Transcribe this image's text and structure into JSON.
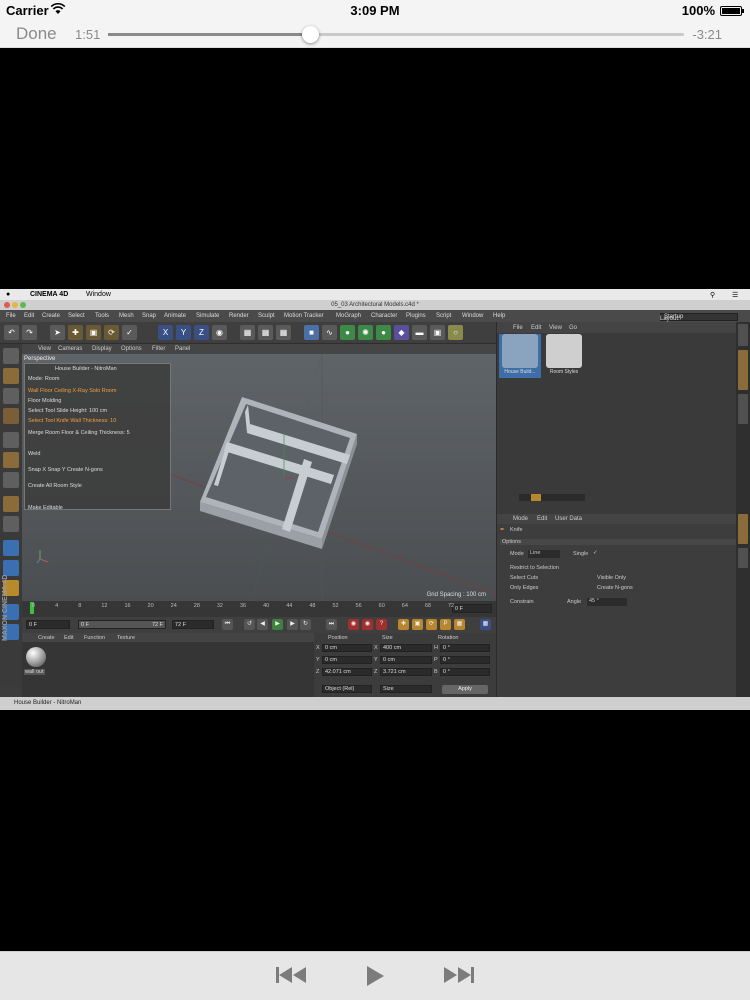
{
  "status_bar": {
    "carrier": "Carrier",
    "time": "3:09 PM",
    "battery": "100%"
  },
  "player": {
    "done_label": "Done",
    "elapsed": "1:51",
    "remaining": "-3:21",
    "progress": 0.35
  },
  "video": {
    "mac_menu": {
      "app": "CINEMA 4D",
      "items": [
        "Window"
      ]
    },
    "window_title": "05_03 Architectural Models.c4d *",
    "menu": [
      "File",
      "Edit",
      "Create",
      "Select",
      "Tools",
      "Mesh",
      "Snap",
      "Animate",
      "Simulate",
      "Render",
      "Sculpt",
      "Motion Tracker",
      "MoGraph",
      "Character",
      "Plugins",
      "Script",
      "Window",
      "Help"
    ],
    "layout_label": "Layout:",
    "layout_value": "Startup",
    "viewport_menu": [
      "View",
      "Cameras",
      "Display",
      "Options",
      "Filter",
      "Panel"
    ],
    "viewport_name": "Perspective",
    "house_builder": {
      "title": "House Builder - NitroMan",
      "rows": [
        "Mode: Room",
        "Wall Floor Ceiling  X-Ray     Solo Room",
        "Floor Molding",
        "Select Tool Slide   Height:   100 cm",
        "Select Tool Knife  Wall Thickness:   10",
        "Merge Room       Floor & Ceiling Thickness:   5",
        "Weld",
        "Snap X  Snap Y      Create N-gons",
        "Create All Room Style",
        "Make Editable"
      ]
    },
    "grid_spacing": "Grid Spacing : 100 cm",
    "timeline_ticks": [
      "0",
      "4",
      "8",
      "12",
      "16",
      "20",
      "24",
      "28",
      "32",
      "36",
      "40",
      "44",
      "48",
      "52",
      "56",
      "60",
      "64",
      "68",
      "72"
    ],
    "frame_end": "0 F",
    "transport": {
      "start": "0 F",
      "cur": "0 F",
      "end": "72 F",
      "end2": "72 F"
    },
    "material_menu": [
      "Create",
      "Edit",
      "Function",
      "Texture"
    ],
    "material_name": "wall out",
    "coords": {
      "headers": [
        "Position",
        "Size",
        "Rotation"
      ],
      "rows": [
        {
          "a": "X",
          "p": "0 cm",
          "b": "X",
          "s": "400 cm",
          "c": "H",
          "r": "0 °"
        },
        {
          "a": "Y",
          "p": "0 cm",
          "b": "Y",
          "s": "0 cm",
          "c": "P",
          "r": "0 °"
        },
        {
          "a": "Z",
          "p": "42.071 cm",
          "b": "Z",
          "s": "3.721 cm",
          "c": "B",
          "r": "0 °"
        }
      ],
      "mode": "Object (Rel)",
      "size_mode": "Size",
      "apply": "Apply"
    },
    "object_menu": [
      "File",
      "Edit",
      "View",
      "Go"
    ],
    "objects": [
      "House Build...",
      "Room Styles"
    ],
    "attr_menu": [
      "Mode",
      "Edit",
      "User Data"
    ],
    "attr": {
      "tool": "Knife",
      "section": "Options",
      "mode_label": "Mode",
      "mode_value": "Line",
      "single": "Single",
      "restrict": "Restrict to Selection",
      "select_cuts": "Select Cuts",
      "visible_only": "Visible Only",
      "only_edges": "Only Edges",
      "create_ngons": "Create N-gons",
      "constrain": "Constrain",
      "angle_label": "Angle",
      "angle_value": "45 °"
    },
    "status": "House Builder - NitroMan",
    "maxon": "MAXON CINEMA 4D"
  }
}
